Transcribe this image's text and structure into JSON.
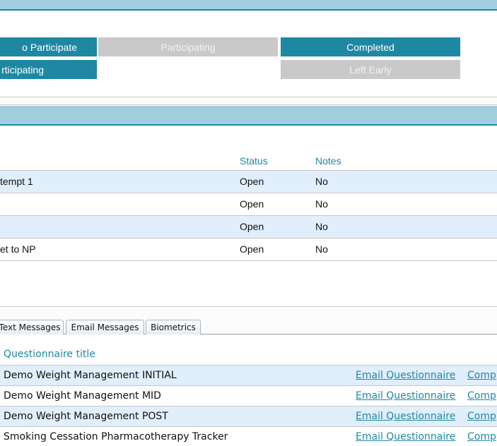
{
  "status_buttons": [
    {
      "label": "o Participate",
      "state": "active"
    },
    {
      "label": "Participating",
      "state": "inactive"
    },
    {
      "label": "Completed",
      "state": "active"
    },
    {
      "label": "rticipating",
      "state": "active"
    },
    {
      "label": "Left Early",
      "state": "inactive"
    }
  ],
  "tasks_table": {
    "headers": {
      "status": "Status",
      "notes": "Notes"
    },
    "rows": [
      {
        "name": "tempt 1",
        "status": "Open",
        "notes": "No"
      },
      {
        "name": "",
        "status": "Open",
        "notes": "No"
      },
      {
        "name": "",
        "status": "Open",
        "notes": "No"
      },
      {
        "name": "et to NP",
        "status": "Open",
        "notes": "No"
      }
    ]
  },
  "tabs": [
    {
      "label": "Text Messages"
    },
    {
      "label": "Email Messages"
    },
    {
      "label": "Biometrics"
    }
  ],
  "questionnaires": {
    "header": "Questionnaire title",
    "rows": [
      {
        "title": "Demo Weight Management INITIAL",
        "email_link": "Email Questionnaire",
        "complete_link": "Comp"
      },
      {
        "title": "Demo Weight Management MID",
        "email_link": "Email Questionnaire",
        "complete_link": "Comp"
      },
      {
        "title": "Demo Weight Management POST",
        "email_link": "Email Questionnaire",
        "complete_link": "Comp"
      },
      {
        "title": "Smoking Cessation Pharmacotherapy Tracker",
        "email_link": "Email Questionnaire",
        "complete_link": "Comp"
      }
    ]
  },
  "colors": {
    "accent": "#1e88a3",
    "header_band": "#9fcfdf",
    "inactive_button": "#c9c9c9",
    "row_alt": "#e1eefb"
  }
}
